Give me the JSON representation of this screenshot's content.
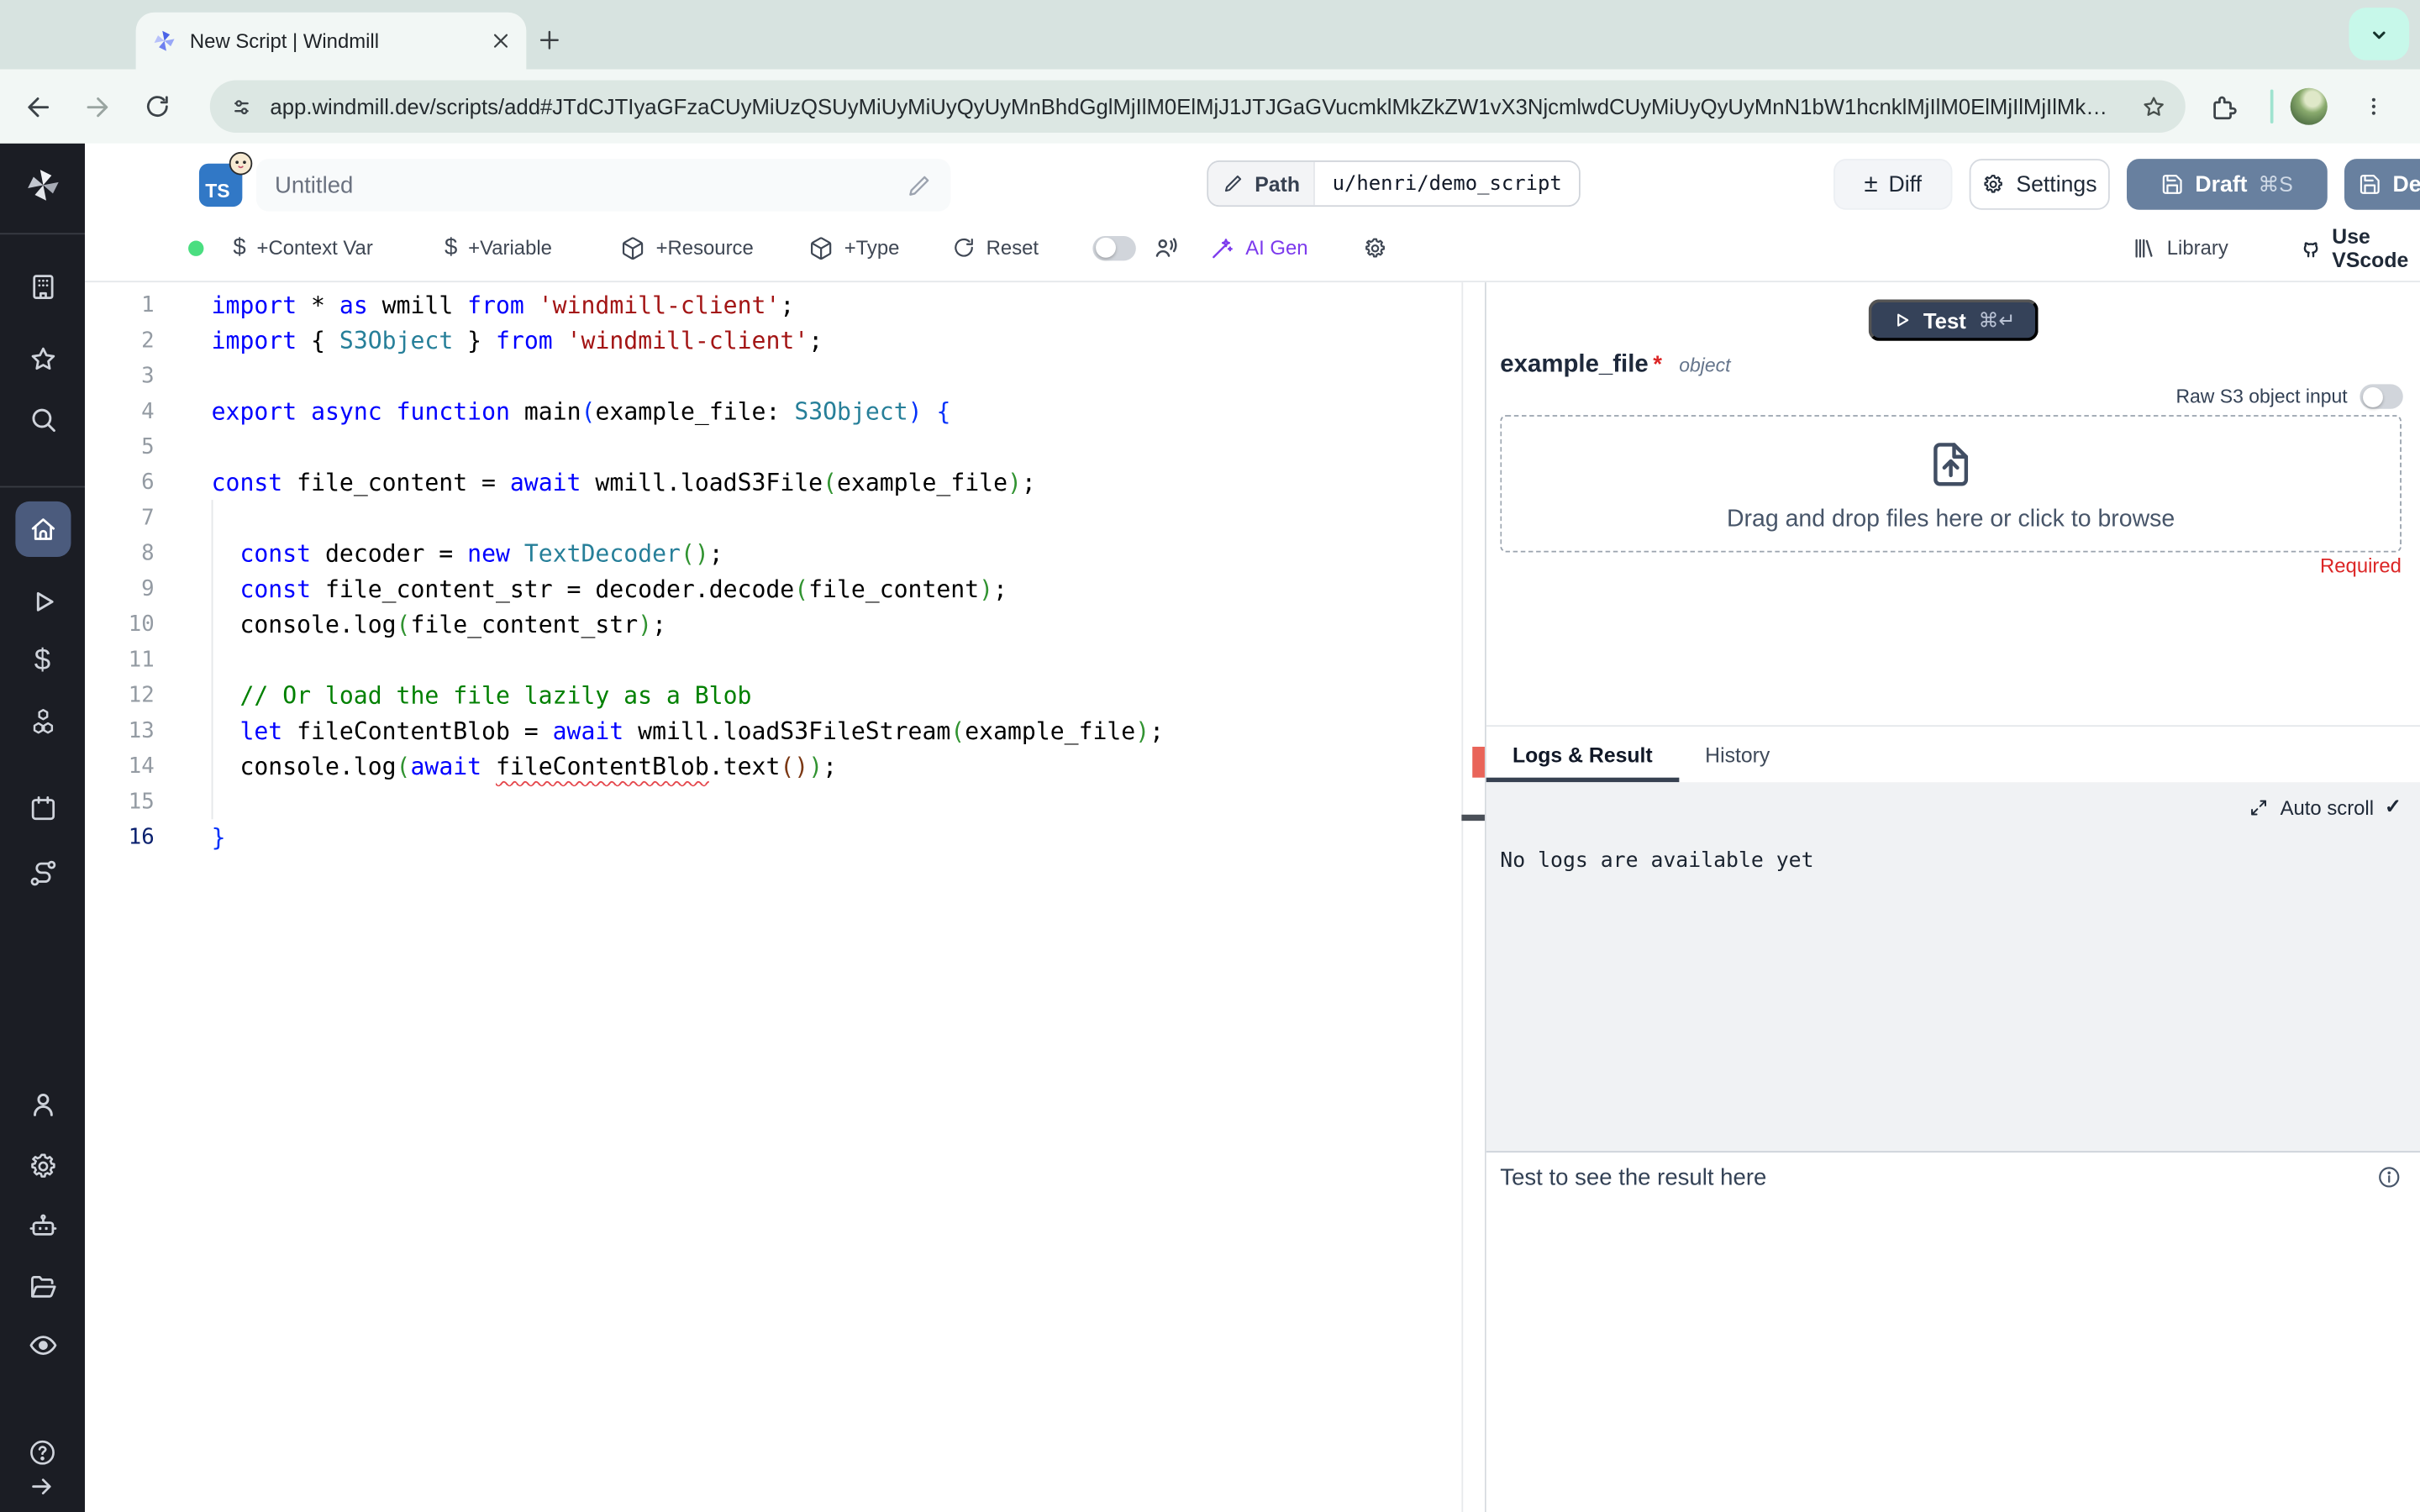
{
  "colors": {
    "chrome_strip": "#d7e3e0",
    "chrome_toolbar": "#f2f7f5",
    "url_pill": "#dce7e3",
    "profile_button": "#c7f8ea",
    "sidebar_bg": "#1b1d24",
    "sidebar_active_bg": "#4b5b7d",
    "ts_badge_blue": "#3178c6",
    "accent_slate_button": "#68809f",
    "test_button": "#354259",
    "ai_gen_purple": "#7c3aed",
    "required_red": "#dc2626",
    "status_green": "#4ade80",
    "error_marker": "#e96459",
    "log_bg": "#f0f2f4",
    "code_keyword": "#0000ff",
    "code_string": "#a31515",
    "code_type": "#267f99",
    "code_comment": "#008000"
  },
  "browser": {
    "tab_title": "New Script | Windmill",
    "url": "app.windmill.dev/scripts/add#JTdCJTIyaGFzaCUyMiUzQSUyMiUyMiUyQyUyMnBhdGglMjIlM0ElMjJ1JTJGaGVucmklMkZkZW1vX3NjcmlwdCUyMiUyQyUyMnN1bW1hcnklMjIlM0ElMjIlMjIlMkMlMjJjb250ZW50JTIy"
  },
  "header": {
    "lang_badge": "TS",
    "script_title": "Untitled",
    "path_label": "Path",
    "path_value": "u/henri/demo_script",
    "diff_icon": "±",
    "diff_label": "Diff",
    "settings_label": "Settings",
    "draft_label": "Draft",
    "draft_shortcut": "⌘S",
    "deploy_label": "Deploy"
  },
  "toolbar": {
    "context_var_label": "+Context Var",
    "variable_label": "+Variable",
    "resource_label": "+Resource",
    "type_label": "+Type",
    "reset_label": "Reset",
    "ai_gen_label": "AI Gen",
    "library_label": "Library",
    "vscode_label": "Use VScode"
  },
  "sidebar": {
    "items": [
      {
        "icon": "workspace"
      },
      {
        "icon": "favorites"
      },
      {
        "icon": "search"
      },
      {
        "icon": "home",
        "active": true
      },
      {
        "icon": "runs"
      },
      {
        "icon": "variables"
      },
      {
        "icon": "resources"
      },
      {
        "icon": "schedules"
      },
      {
        "icon": "flows"
      },
      {
        "icon": "users"
      },
      {
        "icon": "settings"
      },
      {
        "icon": "workers"
      },
      {
        "icon": "folders"
      },
      {
        "icon": "audit-logs"
      },
      {
        "icon": "help",
        "small": true
      },
      {
        "icon": "collapse",
        "small": true
      }
    ]
  },
  "editor": {
    "active_line": 16,
    "lines": [
      {
        "n": 1,
        "toks": [
          [
            "kw",
            "import"
          ],
          [
            "pl",
            " * "
          ],
          [
            "kw",
            "as"
          ],
          [
            "pl",
            " wmill "
          ],
          [
            "kw",
            "from"
          ],
          [
            "pl",
            " "
          ],
          [
            "str",
            "'windmill-client'"
          ],
          [
            "pl",
            ";"
          ]
        ]
      },
      {
        "n": 2,
        "toks": [
          [
            "kw",
            "import"
          ],
          [
            "pl",
            " { "
          ],
          [
            "ty",
            "S3Object"
          ],
          [
            "pl",
            " } "
          ],
          [
            "kw",
            "from"
          ],
          [
            "pl",
            " "
          ],
          [
            "str",
            "'windmill-client'"
          ],
          [
            "pl",
            ";"
          ]
        ]
      },
      {
        "n": 3,
        "toks": []
      },
      {
        "n": 4,
        "toks": [
          [
            "kw",
            "export"
          ],
          [
            "pl",
            " "
          ],
          [
            "kw",
            "async"
          ],
          [
            "pl",
            " "
          ],
          [
            "kw",
            "function"
          ],
          [
            "pl",
            " main"
          ],
          [
            "br1",
            "("
          ],
          [
            "pl",
            "example_file: "
          ],
          [
            "ty",
            "S3Object"
          ],
          [
            "br1",
            ")"
          ],
          [
            "pl",
            " "
          ],
          [
            "br1",
            "{"
          ]
        ]
      },
      {
        "n": 5,
        "toks": []
      },
      {
        "n": 6,
        "toks": [
          [
            "kw",
            "const"
          ],
          [
            "pl",
            " file_content = "
          ],
          [
            "kw",
            "await"
          ],
          [
            "pl",
            " wmill.loadS3File"
          ],
          [
            "br2",
            "("
          ],
          [
            "pl",
            "example_file"
          ],
          [
            "br2",
            ")"
          ],
          [
            "pl",
            ";"
          ]
        ]
      },
      {
        "n": 7,
        "toks": []
      },
      {
        "n": 8,
        "toks": [
          [
            "pl",
            "  "
          ],
          [
            "kw",
            "const"
          ],
          [
            "pl",
            " decoder = "
          ],
          [
            "kw",
            "new"
          ],
          [
            "pl",
            " "
          ],
          [
            "ty",
            "TextDecoder"
          ],
          [
            "br2",
            "()"
          ],
          [
            "pl",
            ";"
          ]
        ]
      },
      {
        "n": 9,
        "toks": [
          [
            "pl",
            "  "
          ],
          [
            "kw",
            "const"
          ],
          [
            "pl",
            " file_content_str = decoder.decode"
          ],
          [
            "br2",
            "("
          ],
          [
            "pl",
            "file_content"
          ],
          [
            "br2",
            ")"
          ],
          [
            "pl",
            ";"
          ]
        ]
      },
      {
        "n": 10,
        "toks": [
          [
            "pl",
            "  console.log"
          ],
          [
            "br2",
            "("
          ],
          [
            "pl",
            "file_content_str"
          ],
          [
            "br2",
            ")"
          ],
          [
            "pl",
            ";"
          ]
        ]
      },
      {
        "n": 11,
        "toks": []
      },
      {
        "n": 12,
        "toks": [
          [
            "cm",
            "  // Or load the file lazily as a Blob"
          ]
        ]
      },
      {
        "n": 13,
        "toks": [
          [
            "pl",
            "  "
          ],
          [
            "kw",
            "let"
          ],
          [
            "pl",
            " fileContentBlob = "
          ],
          [
            "kw",
            "await"
          ],
          [
            "pl",
            " wmill.loadS3FileStream"
          ],
          [
            "br2",
            "("
          ],
          [
            "pl",
            "example_file"
          ],
          [
            "br2",
            ")"
          ],
          [
            "pl",
            ";"
          ]
        ]
      },
      {
        "n": 14,
        "toks": [
          [
            "pl",
            "  console.log"
          ],
          [
            "br2",
            "("
          ],
          [
            "kw",
            "await"
          ],
          [
            "pl",
            " "
          ],
          [
            "sq",
            "fileContentBlob"
          ],
          [
            "pl",
            ".text"
          ],
          [
            "br3",
            "()"
          ],
          [
            "br2",
            ")"
          ],
          [
            "pl",
            ";"
          ]
        ]
      },
      {
        "n": 15,
        "toks": []
      },
      {
        "n": 16,
        "toks": [
          [
            "br1",
            "}"
          ]
        ]
      }
    ]
  },
  "panel": {
    "test_label": "Test",
    "test_shortcut": "⌘↵",
    "arg_name": "example_file",
    "arg_required_mark": "*",
    "arg_type": "object",
    "raw_s3_label": "Raw S3 object input",
    "dropzone_label": "Drag and drop files here or click to browse",
    "required_label": "Required",
    "tab_logs": "Logs & Result",
    "tab_history": "History",
    "auto_scroll_label": "Auto scroll",
    "auto_scroll_check": "✓",
    "no_logs_text": "No logs are available yet",
    "result_placeholder": "Test to see the result here"
  }
}
